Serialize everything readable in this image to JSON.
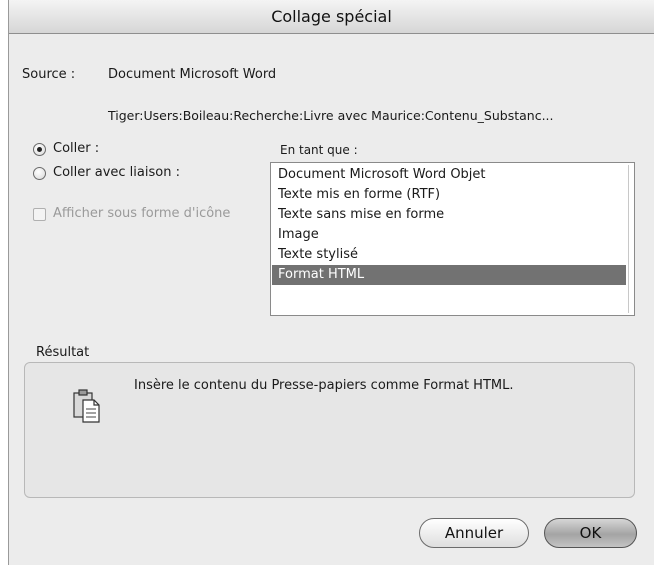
{
  "window": {
    "title": "Collage spécial"
  },
  "source": {
    "label": "Source :",
    "value": "Document Microsoft Word",
    "path": "Tiger:Users:Boileau:Recherche:Livre avec Maurice:Contenu_Substanc..."
  },
  "options": {
    "paste_label": "Coller :",
    "paste_link_label": "Coller avec liaison :",
    "show_as_icon_label": "Afficher sous forme d'icône",
    "selected": "paste"
  },
  "as": {
    "label": "En tant que :",
    "items": [
      "Document Microsoft Word Objet",
      "Texte mis en forme (RTF)",
      "Texte sans mise en forme",
      "Image",
      "Texte stylisé",
      "Format HTML"
    ],
    "selected_item": "Format HTML"
  },
  "result": {
    "label": "Résultat",
    "text": "Insère le contenu du Presse-papiers comme Format HTML.",
    "icon": "clipboard-icon"
  },
  "buttons": {
    "cancel": "Annuler",
    "ok": "OK"
  }
}
